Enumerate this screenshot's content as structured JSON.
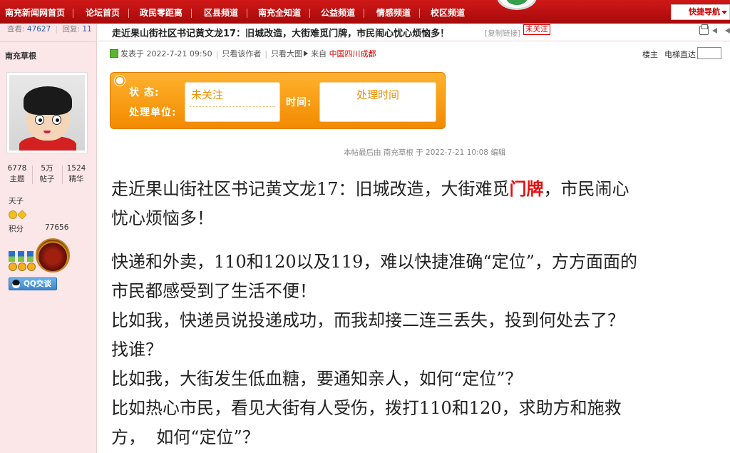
{
  "nav": {
    "items": [
      "南充新闻网首页",
      "论坛首页",
      "政民零距离",
      "区县频道",
      "南充全知道",
      "公益频道",
      "情感频道",
      "校区频道"
    ],
    "quick_nav": "快捷导航"
  },
  "thread_stats": {
    "views_label": "查看:",
    "views": "47627",
    "replies_label": "回复:",
    "replies": "11"
  },
  "author": {
    "name": "南充草根",
    "stats": [
      {
        "value": "6778",
        "label": "主题"
      },
      {
        "value": "5万",
        "label": "帖子"
      },
      {
        "value": "1524",
        "label": "精华"
      }
    ],
    "rank": "天子",
    "score_label": "积分",
    "score": "77656",
    "qq_button": "QQ交谈"
  },
  "post": {
    "title": "走近果山街社区书记黄文龙17：旧城改造，大街难觅门牌，市民闹心忧心烦恼多！",
    "copy_link": "[复制链接]",
    "status_tag": "未关注",
    "meta": {
      "posted": "发表于 2022-7-21 09:50",
      "only_author": "只看该作者",
      "only_large_images": "只看大图",
      "from_label": "来自",
      "location": "中国四川成都"
    },
    "floor": "楼主",
    "elevator": "电梯直达",
    "status_box": {
      "status_label": "状 态:",
      "unit_label": "处理单位:",
      "status_value": "未关注",
      "time_label": "时间:",
      "time_value": "处理时间"
    },
    "edit_note": "本帖最后由 南充草根 于 2022-7-21 10:08 编辑",
    "headline_pre": "走近果山街社区书记黄文龙17：旧城改造，大街难觅",
    "headline_highlight": "门牌",
    "headline_post": "，市民闹心",
    "headline_line2": "忧心烦恼多！",
    "body": [
      "快递和外卖，110和120以及119，难以快捷准确“定位”，方方面面的",
      "市民都感受到了生活不便！",
      "比如我，快递员说投递成功，而我却接二连三丢失，投到何处去了？",
      "找谁？",
      "比如我，大街发生低血糖，要通知亲人，如何“定位”？",
      "比如热心市民，看见大街有人受伤，拨打110和120，求助方和施救",
      "方，  如何“定位”？"
    ]
  }
}
